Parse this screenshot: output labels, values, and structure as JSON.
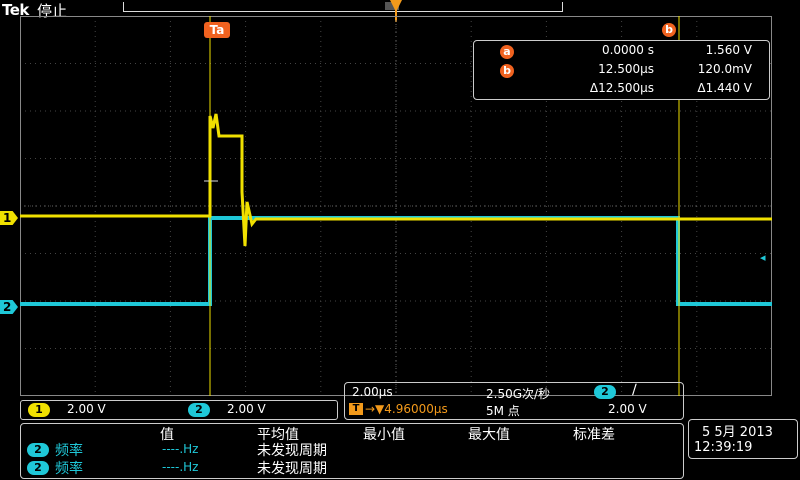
{
  "header": {
    "brand": "Tek",
    "run_state": "停止"
  },
  "colors": {
    "ch1": "#f0e000",
    "ch2": "#1fc8d8",
    "cursor": "#f0621f",
    "trigger": "#f39a1b"
  },
  "channels": [
    {
      "id": "1",
      "scale": "2.00 V"
    },
    {
      "id": "2",
      "scale": "2.00 V"
    }
  ],
  "cursors": {
    "a_label": "a",
    "b_label": "b",
    "rows": [
      {
        "icon": "a",
        "time": "0.0000 s",
        "value": "1.560 V"
      },
      {
        "icon": "b",
        "time": "12.500μs",
        "value": "120.0mV"
      },
      {
        "icon": "",
        "time": "Δ12.500μs",
        "value": "Δ1.440 V"
      }
    ]
  },
  "horizontal": {
    "time_div": "2.00μs",
    "sample_rate": "2.50G次/秒",
    "trigger_source": "2",
    "trigger_slope": "∕",
    "trigger_pos_icon": "T",
    "trigger_position": "→▼4.96000μs",
    "record_length": "5M 点",
    "trigger_level": "2.00 V"
  },
  "measurements": {
    "headers": {
      "value": "值",
      "mean": "平均值",
      "min": "最小值",
      "max": "最大值",
      "std": "标准差"
    },
    "rows": [
      {
        "channel": "2",
        "name": "频率",
        "value": "----.Hz",
        "mean": "未发现周期"
      },
      {
        "channel": "2",
        "name": "频率",
        "value": "----.Hz",
        "mean": "未发现周期"
      }
    ]
  },
  "datetime": {
    "date": "5 5月  2013",
    "time": "12:39:19"
  }
}
